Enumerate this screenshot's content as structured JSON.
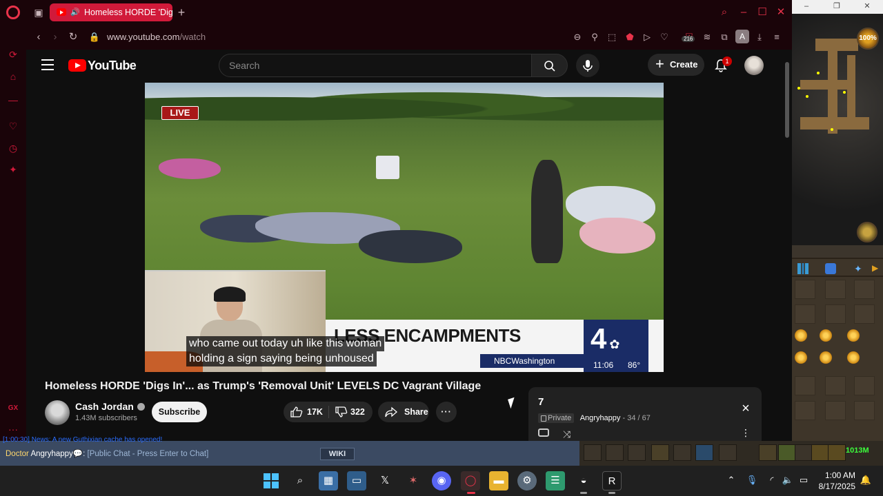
{
  "browser": {
    "tab_title": "Homeless HORDE 'Dig",
    "url_host": "www.youtube.com",
    "url_path": "/watch",
    "extension_badge": "216",
    "profile_letter": "A",
    "gx_label": "GX"
  },
  "youtube": {
    "logo_text": "YouTube",
    "search_placeholder": "Search",
    "create_label": "Create",
    "notification_count": "1",
    "video": {
      "live_label": "LIVE",
      "headline": "LESS ENCAMPMENTS",
      "brand_bar": "NBCWashington",
      "station_number": "4",
      "clock": "11:06",
      "temperature": "86°",
      "caption_line1": "who came out today uh like this woman",
      "caption_line2": "holding a sign saying being unhoused"
    },
    "title": "Homeless HORDE 'Digs In'... as Trump's 'Removal Unit' LEVELS DC Vagrant Village",
    "channel_name": "Cash Jordan",
    "subscribers": "1.43M subscribers",
    "subscribe_label": "Subscribe",
    "likes": "17K",
    "dislikes": "322",
    "share_label": "Share",
    "more_label": "···",
    "playlist": {
      "title": "7",
      "privacy": "Private",
      "owner": "Angryhappy",
      "position": "- 34 / 67",
      "more_label": "⋮"
    }
  },
  "game": {
    "hp_orb_text": "100%",
    "chat_top_text": "[1:00:30] News: A new Guthixian cache has opened!",
    "chat_rank": "Doctor",
    "chat_user": "Angryhappy",
    "chat_hint": "[Public Chat - Press Enter to Chat]",
    "wiki_label": "WIKI",
    "memory": "1013M"
  },
  "taskbar": {
    "time": "1:00 AM",
    "date": "8/17/2025"
  },
  "colors": {
    "opera_accent": "#d11a3a",
    "youtube_red": "#ff0000",
    "taskbar_bg": "#202020"
  }
}
